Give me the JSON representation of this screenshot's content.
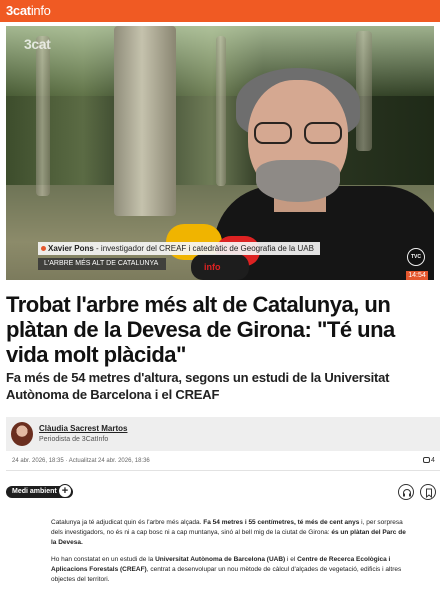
{
  "header": {
    "brand_a": "3cat",
    "brand_b": "info",
    "brand_color": "#f05a23"
  },
  "video": {
    "logo": "3cat",
    "caption_name": "Xavier Pons",
    "caption_role": " - investigador del CREAF i catedràtic de Geografia de la UAB",
    "caption_topic": "L'ARBRE MÉS ALT DE CATALUNYA",
    "channel_badge": "TVC",
    "time": "14:54",
    "mic_label": "info"
  },
  "article": {
    "headline": "Trobat l'arbre més alt de Catalunya, un plàtan de la Devesa de Girona: \"Té una vida molt plàcida\"",
    "subtitle": "Fa més de 54 metres d'altura, segons un estudi de la Universitat Autònoma de Barcelona i el CREAF"
  },
  "author": {
    "name": "Clàudia Sacrest Martos",
    "role": "Periodista de 3CatInfo"
  },
  "meta": {
    "dates": "24 abr. 2026, 18:35 · Actualitzat 24 abr. 2026, 18:36",
    "comments_count": "4"
  },
  "tag": {
    "label": "Medi ambient",
    "plus": "+"
  },
  "body": {
    "p1": [
      {
        "t": "Catalunya ja té adjudicat quin és l'arbre més alçada. ",
        "b": false
      },
      {
        "t": "Fa 54 metres i 55 centímetres, té més de cent anys",
        "b": true
      },
      {
        "t": " i, per sorpresa dels investigadors, no és ni a cap bosc ni a cap muntanya, sinó al bell mig de la ciutat de Girona: ",
        "b": false
      },
      {
        "t": "és un plàtan del Parc de la Devesa.",
        "b": true
      }
    ],
    "p2": [
      {
        "t": "Ho han constatat en un estudi de la ",
        "b": false
      },
      {
        "t": "Universitat Autònoma de Barcelona (UAB)",
        "b": true
      },
      {
        "t": " i el ",
        "b": false
      },
      {
        "t": "Centre de Recerca Ecològica i Aplicacions Forestals (CREAF)",
        "b": true
      },
      {
        "t": ", centrat a desenvolupar un nou mètode de càlcul d'alçades de vegetació, edificis i altres objectes del territori.",
        "b": false
      }
    ]
  },
  "icons": {
    "listen": "headphones-icon",
    "save": "bookmark-icon",
    "comments": "comment-icon"
  }
}
